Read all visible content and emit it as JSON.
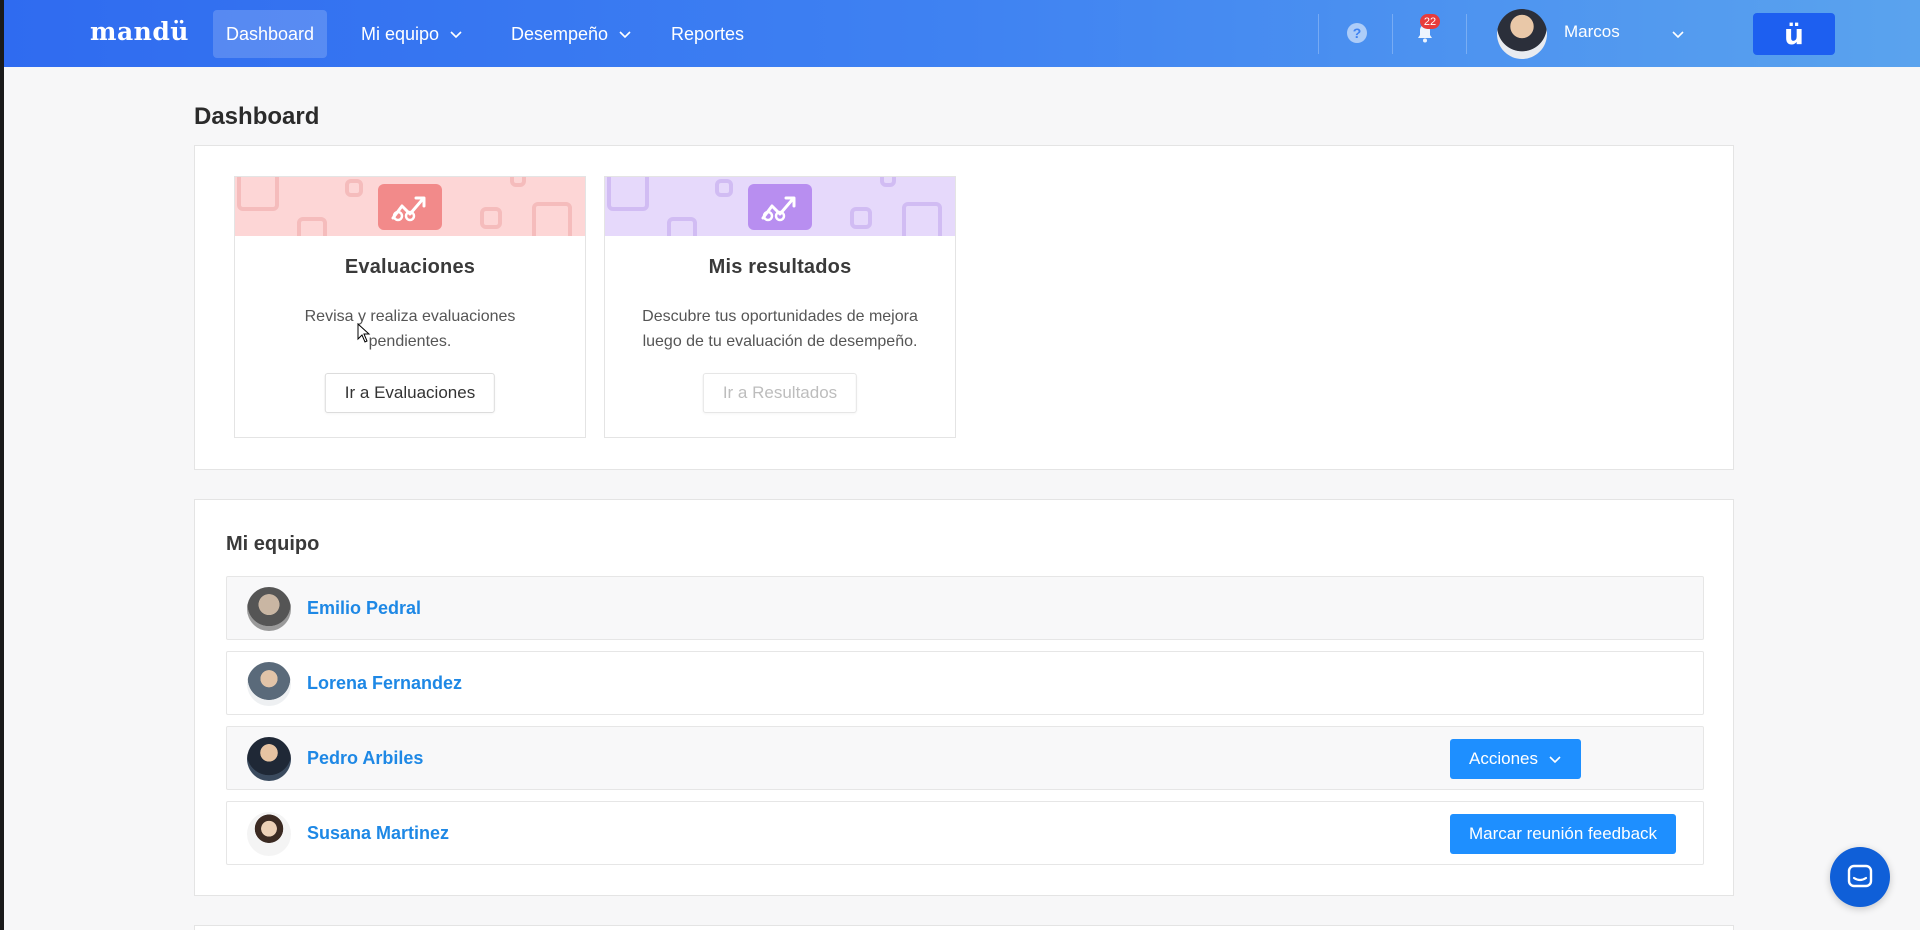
{
  "nav": {
    "logo": "mandü",
    "items": [
      {
        "label": "Dashboard",
        "active": true,
        "has_dropdown": false
      },
      {
        "label": "Mi equipo",
        "active": false,
        "has_dropdown": true
      },
      {
        "label": "Desempeño",
        "active": false,
        "has_dropdown": true
      },
      {
        "label": "Reportes",
        "active": false,
        "has_dropdown": false
      }
    ],
    "help_label": "?",
    "notifications_count": "22",
    "user_name": "Marcos",
    "brand_button_label": "ü",
    "gradient": [
      "#2f6bf0",
      "#5aa3ee"
    ]
  },
  "page": {
    "title": "Dashboard"
  },
  "cards": [
    {
      "title": "Evaluaciones",
      "description": "Revisa y realiza evaluaciones pendientes.",
      "button_label": "Ir a Evaluaciones",
      "button_disabled": false,
      "banner_color": "#fdd6d6",
      "icon_color": "#f28a8a",
      "icon": "trending-up-icon"
    },
    {
      "title": "Mis resultados",
      "description": "Descubre tus oportunidades de mejora luego de tu evaluación de desempeño.",
      "button_label": "Ir a Resultados",
      "button_disabled": true,
      "banner_color": "#e6d9fb",
      "icon_color": "#b88ef0",
      "icon": "trending-up-icon"
    }
  ],
  "team": {
    "title": "Mi equipo",
    "members": [
      {
        "name": "Emilio Pedral",
        "action": null
      },
      {
        "name": "Lorena Fernandez",
        "action": null
      },
      {
        "name": "Pedro Arbiles",
        "action": "Acciones"
      },
      {
        "name": "Susana Martinez",
        "action": "Marcar reunión feedback"
      }
    ]
  },
  "colors": {
    "accent": "#1e8fff",
    "link": "#1e88e5",
    "chat": "#0f5fd8"
  }
}
